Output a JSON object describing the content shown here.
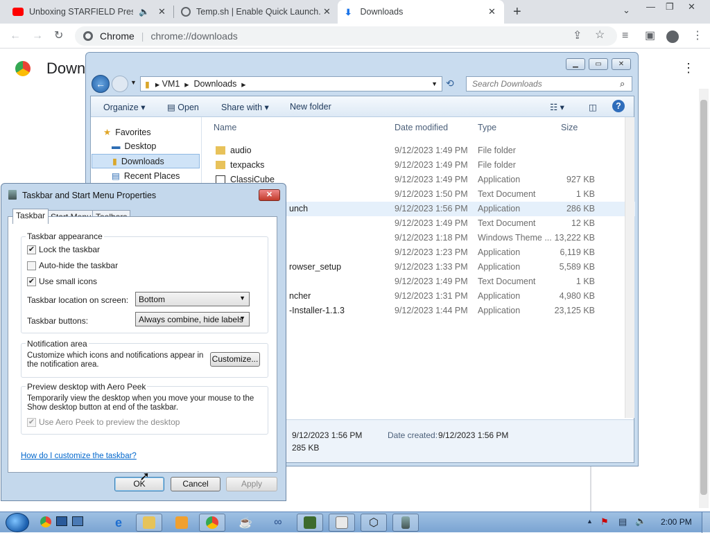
{
  "browser": {
    "tabs": [
      {
        "title": "Unboxing STARFIELD Press K"
      },
      {
        "title": "Temp.sh | Enable Quick Launch.e"
      },
      {
        "title": "Downloads"
      }
    ],
    "omnibox_scheme": "Chrome",
    "omnibox_url": "chrome://downloads",
    "page_title": "Down"
  },
  "explorer": {
    "breadcrumb": [
      "VM1",
      "Downloads"
    ],
    "search_placeholder": "Search Downloads",
    "commands": {
      "organize": "Organize",
      "open": "Open",
      "share": "Share with",
      "new_folder": "New folder"
    },
    "nav": {
      "favorites": "Favorites",
      "desktop": "Desktop",
      "downloads": "Downloads",
      "recent": "Recent Places"
    },
    "columns": {
      "name": "Name",
      "date": "Date modified",
      "type": "Type",
      "size": "Size"
    },
    "files": [
      {
        "name": "audio",
        "date": "9/12/2023 1:49 PM",
        "type": "File folder",
        "size": ""
      },
      {
        "name": "texpacks",
        "date": "9/12/2023 1:49 PM",
        "type": "File folder",
        "size": ""
      },
      {
        "name": "ClassiCube",
        "date": "9/12/2023 1:49 PM",
        "type": "Application",
        "size": "927 KB"
      },
      {
        "name": "",
        "date": "9/12/2023 1:50 PM",
        "type": "Text Document",
        "size": "1 KB"
      },
      {
        "name": "unch",
        "date": "9/12/2023 1:56 PM",
        "type": "Application",
        "size": "286 KB"
      },
      {
        "name": "",
        "date": "9/12/2023 1:49 PM",
        "type": "Text Document",
        "size": "12 KB"
      },
      {
        "name": "",
        "date": "9/12/2023 1:18 PM",
        "type": "Windows Theme ...",
        "size": "13,222 KB"
      },
      {
        "name": "",
        "date": "9/12/2023 1:23 PM",
        "type": "Application",
        "size": "6,119 KB"
      },
      {
        "name": "rowser_setup",
        "date": "9/12/2023 1:33 PM",
        "type": "Application",
        "size": "5,589 KB"
      },
      {
        "name": "",
        "date": "9/12/2023 1:49 PM",
        "type": "Text Document",
        "size": "1 KB"
      },
      {
        "name": "ncher",
        "date": "9/12/2023 1:31 PM",
        "type": "Application",
        "size": "4,980 KB"
      },
      {
        "name": "-Installer-1.1.3",
        "date": "9/12/2023 1:44 PM",
        "type": "Application",
        "size": "23,125 KB"
      }
    ],
    "details": {
      "modified": "9/12/2023 1:56 PM",
      "created_label": "Date created:",
      "created": "9/12/2023 1:56 PM",
      "size": "285 KB"
    }
  },
  "dialog": {
    "title": "Taskbar and Start Menu Properties",
    "tabs": [
      "Taskbar",
      "Start Menu",
      "Toolbars"
    ],
    "appearance": {
      "label": "Taskbar appearance",
      "lock": "Lock the taskbar",
      "autohide": "Auto-hide the taskbar",
      "small_icons": "Use small icons",
      "location_label": "Taskbar location on screen:",
      "location_value": "Bottom",
      "buttons_label": "Taskbar buttons:",
      "buttons_value": "Always combine, hide labels"
    },
    "notification": {
      "label": "Notification area",
      "text": "Customize which icons and notifications appear in the notification area.",
      "button": "Customize..."
    },
    "aero": {
      "label": "Preview desktop with Aero Peek",
      "text": "Temporarily view the desktop when you move your mouse to the Show desktop button at end of the taskbar.",
      "checkbox": "Use Aero Peek to preview the desktop"
    },
    "help_link": "How do I customize the taskbar?",
    "ok": "OK",
    "cancel": "Cancel",
    "apply": "Apply"
  },
  "taskbar": {
    "clock": "2:00 PM"
  },
  "colors": {
    "accent": "#1a73e8",
    "taskbar": "#8fb3dc",
    "link": "#0066cc"
  }
}
